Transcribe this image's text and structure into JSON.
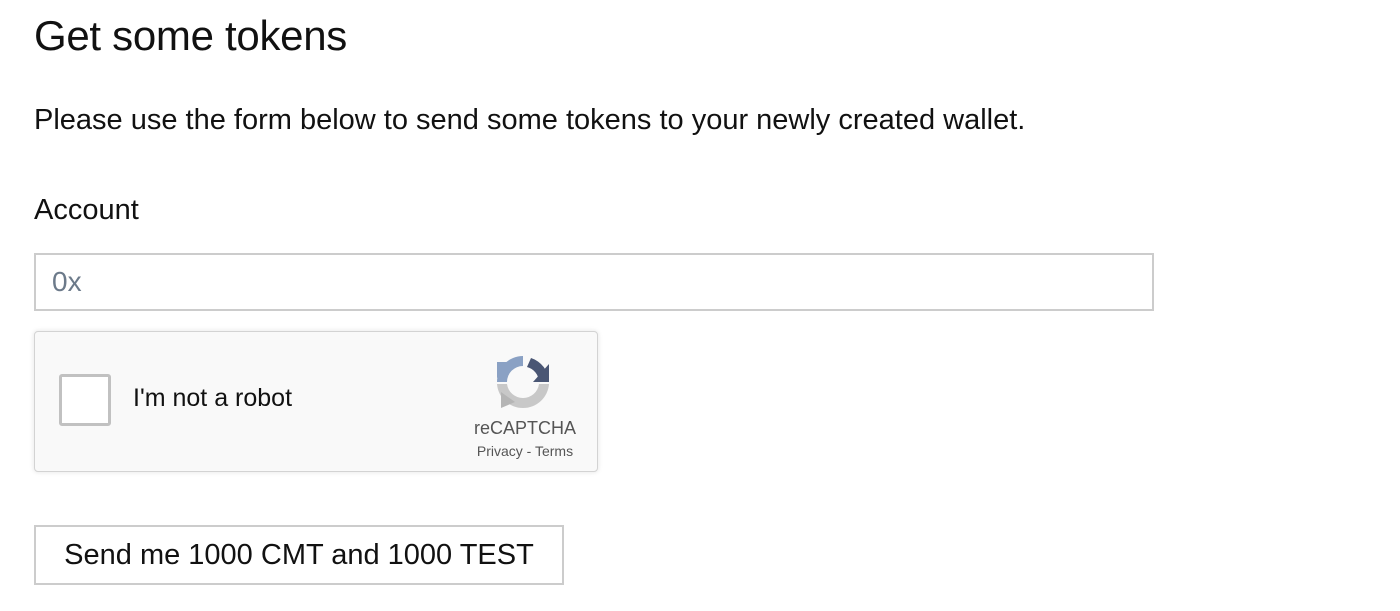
{
  "page": {
    "title": "Get some tokens",
    "intro": "Please use the form below to send some tokens to your newly created wallet."
  },
  "form": {
    "account_label": "Account",
    "account_value": "",
    "account_placeholder": "0x",
    "submit_label": "Send me 1000 CMT and 1000 TEST"
  },
  "recaptcha": {
    "checkbox_label": "I'm not a robot",
    "checked": false,
    "brand": "reCAPTCHA",
    "privacy_label": "Privacy",
    "separator": " - ",
    "terms_label": "Terms",
    "icon": "recaptcha-logo-icon"
  }
}
